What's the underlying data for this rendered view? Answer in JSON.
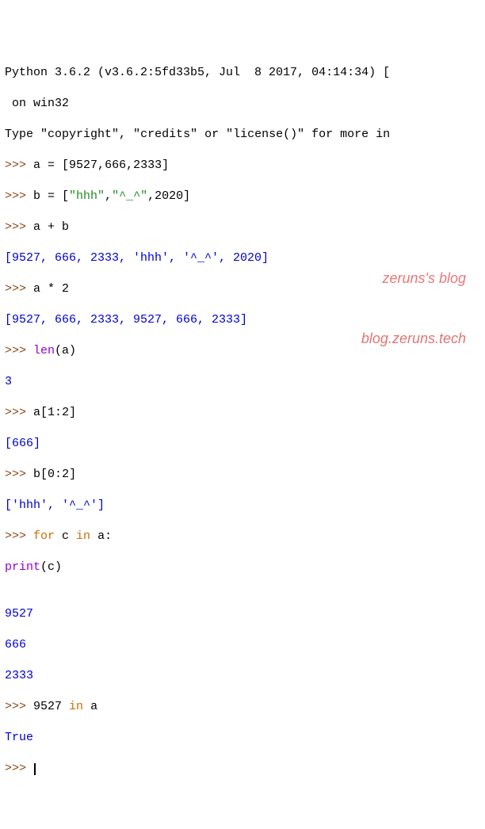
{
  "header": {
    "line1": "Python 3.6.2 (v3.6.2:5fd33b5, Jul  8 2017, 04:14:34) [",
    "line2": " on win32",
    "line3_a": "Type ",
    "line3_b": "\"copyright\"",
    "line3_c": ", ",
    "line3_d": "\"credits\"",
    "line3_e": " or ",
    "line3_f": "\"license()\"",
    "line3_g": " for more in"
  },
  "prompt": ">>> ",
  "cont": "        ",
  "lines": {
    "l1": {
      "code_a": "a = [",
      "code_b": "9527",
      "code_c": ",",
      "code_d": "666",
      "code_e": ",",
      "code_f": "2333",
      "code_g": "]"
    },
    "l2": {
      "code_a": "b = [",
      "str1": "\"hhh\"",
      "c1": ",",
      "str2": "\"^_^\"",
      "c2": ",",
      "num": "2020",
      "end": "]"
    },
    "l3": {
      "code": "a + b"
    },
    "out3": "[9527, 666, 2333, 'hhh', '^_^', 2020]",
    "l4": {
      "code_a": "a * ",
      "num": "2"
    },
    "out4": "[9527, 666, 2333, 9527, 666, 2333]",
    "l5": {
      "fn": "len",
      "paren": "(a)"
    },
    "out5": "3",
    "l6": {
      "code_a": "a[",
      "n1": "1",
      "colon": ":",
      "n2": "2",
      "end": "]"
    },
    "out6": "[666]",
    "l7": {
      "code_a": "b[",
      "n1": "0",
      "colon": ":",
      "n2": "2",
      "end": "]"
    },
    "out7": "['hhh', '^_^']",
    "l8": {
      "kw1": "for",
      "mid": " c ",
      "kw2": "in",
      "end": " a:"
    },
    "l9": {
      "fn": "print",
      "paren": "(c)"
    },
    "blank": "",
    "out9a": "9527",
    "out9b": "666",
    "out9c": "2333",
    "l10": {
      "num": "9527",
      "sp": " ",
      "kw": "in",
      "end": " a"
    },
    "out10": "True"
  },
  "watermark": {
    "l1": "zeruns's blog",
    "l2": "blog.zeruns.tech"
  }
}
